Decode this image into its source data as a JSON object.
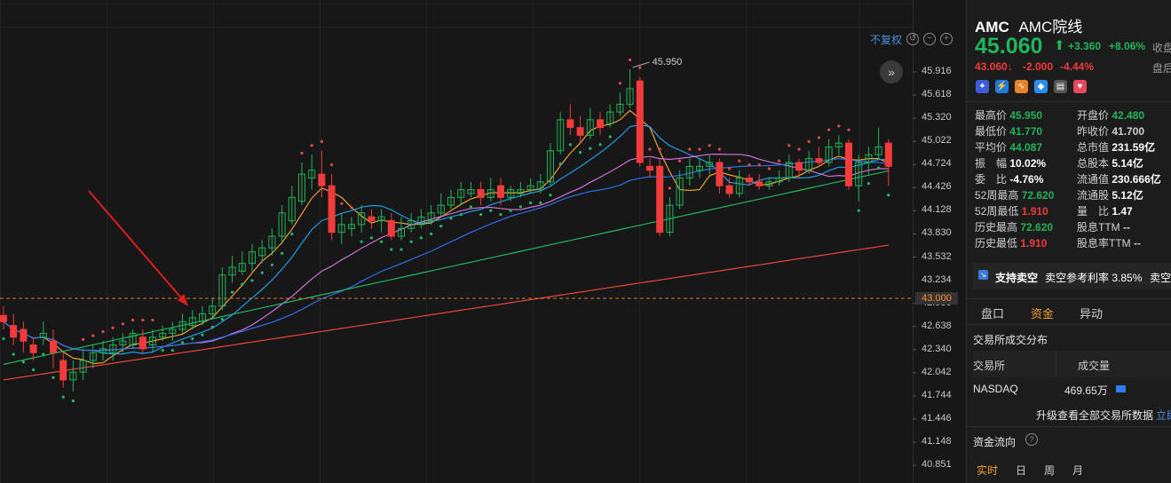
{
  "header": {
    "symbol": "AMC",
    "name": "AMC院线",
    "price": "45.060",
    "arrow": "⬆",
    "change": "+3.360",
    "change_pct": "+8.06%",
    "close_label": "收盘",
    "after_price": "43.060↓",
    "after_change": "-2.000",
    "after_pct": "-4.44%",
    "after_label": "盘后"
  },
  "toolbar": {
    "fq_label": "不复权"
  },
  "stats": [
    {
      "label": "最高价",
      "value": "45.950",
      "color": "#21b45a",
      "label2": "开盘价",
      "value2": "42.480",
      "color2": "#21b45a"
    },
    {
      "label": "最低价",
      "value": "41.770",
      "color": "#21b45a",
      "label2": "昨收价",
      "value2": "41.700",
      "color2": "#cfcfcf"
    },
    {
      "label": "平均价",
      "value": "44.087",
      "color": "#21b45a",
      "label2": "总市值",
      "value2": "231.59亿",
      "color2": "#ffffff"
    },
    {
      "label": "振　幅",
      "value": "10.02%",
      "color": "#ffffff",
      "label2": "总股本",
      "value2": "5.14亿",
      "color2": "#ffffff"
    },
    {
      "label": "委　比",
      "value": "-4.76%",
      "color": "#ffffff",
      "label2": "流通值",
      "value2": "230.666亿",
      "color2": "#ffffff"
    },
    {
      "label": "52周最高",
      "value": "72.620",
      "color": "#21b45a",
      "label2": "流通股",
      "value2": "5.12亿",
      "color2": "#ffffff"
    },
    {
      "label": "52周最低",
      "value": "1.910",
      "color": "#f23b3b",
      "label2": "量　比",
      "value2": "1.47",
      "color2": "#ffffff"
    },
    {
      "label": "历史最高",
      "value": "72.620",
      "color": "#21b45a",
      "label2": "股息TTM",
      "value2": "--",
      "color2": "#cfcfcf"
    },
    {
      "label": "历史最低",
      "value": "1.910",
      "color": "#f23b3b",
      "label2": "股息率TTM",
      "value2": "--",
      "color2": "#cfcfcf"
    }
  ],
  "short": {
    "text": "支持卖空",
    "rate": "卖空参考利率 3.85%",
    "more": "卖空"
  },
  "tabs": {
    "t1": "盘口",
    "t2": "资金",
    "t3": "异动"
  },
  "exchange": {
    "title": "交易所成交分布",
    "col1": "交易所",
    "col2": "成交量",
    "name": "NASDAQ",
    "volume": "469.65万",
    "upgrade": "升级查看全部交易所数据",
    "upgrade_link": "立即"
  },
  "flow": {
    "title": "资金流向",
    "tabs": [
      "实时",
      "日",
      "周",
      "月"
    ]
  },
  "colors": {
    "up": "#f23b3b",
    "down": "#21b45a",
    "ma5": "#f0a030",
    "ma10": "#1f9ce6",
    "ma20": "#d070d8",
    "ma30": "#2e6fe8",
    "ma60": "#22b866",
    "ma120": "#e8453c",
    "sar": "#e04a4a",
    "sar_below": "#22b866",
    "accent": "#4a90e2"
  },
  "chart_data": {
    "type": "candlestick",
    "y_ticks": [
      "45.916",
      "45.618",
      "45.320",
      "45.022",
      "44.724",
      "44.426",
      "44.128",
      "43.830",
      "43.532",
      "43.234",
      "42.936",
      "42.638",
      "42.340",
      "42.042",
      "41.744",
      "41.446",
      "41.148",
      "40.851"
    ],
    "ylim": [
      40.851,
      45.916
    ],
    "current_price_label": "43.000",
    "current_price_line": 43.0,
    "annotation": "45.950",
    "candles": [
      [
        42.78,
        42.7,
        42.9,
        42.6
      ],
      [
        42.65,
        42.5,
        42.8,
        42.4
      ],
      [
        42.6,
        42.45,
        42.7,
        42.3
      ],
      [
        42.4,
        42.3,
        42.5,
        42.2
      ],
      [
        42.5,
        42.55,
        42.7,
        42.4
      ],
      [
        42.45,
        42.3,
        42.6,
        42.1
      ],
      [
        42.2,
        41.95,
        42.3,
        41.85
      ],
      [
        41.95,
        42.05,
        42.2,
        41.8
      ],
      [
        42.05,
        42.2,
        42.35,
        41.95
      ],
      [
        42.2,
        42.3,
        42.4,
        42.1
      ],
      [
        42.3,
        42.35,
        42.45,
        42.2
      ],
      [
        42.3,
        42.4,
        42.5,
        42.2
      ],
      [
        42.4,
        42.45,
        42.55,
        42.3
      ],
      [
        42.4,
        42.55,
        42.6,
        42.35
      ],
      [
        42.5,
        42.35,
        42.6,
        42.3
      ],
      [
        42.4,
        42.5,
        42.6,
        42.3
      ],
      [
        42.5,
        42.55,
        42.65,
        42.45
      ],
      [
        42.55,
        42.6,
        42.7,
        42.45
      ],
      [
        42.6,
        42.7,
        42.8,
        42.55
      ],
      [
        42.65,
        42.75,
        42.85,
        42.6
      ],
      [
        42.7,
        42.8,
        42.9,
        42.65
      ],
      [
        42.8,
        42.9,
        43.0,
        42.75
      ],
      [
        42.9,
        43.3,
        43.4,
        42.85
      ],
      [
        43.3,
        43.4,
        43.55,
        43.2
      ],
      [
        43.35,
        43.45,
        43.6,
        43.3
      ],
      [
        43.45,
        43.6,
        43.7,
        43.35
      ],
      [
        43.55,
        43.65,
        43.75,
        43.45
      ],
      [
        43.65,
        43.8,
        43.9,
        43.55
      ],
      [
        43.8,
        44.1,
        44.2,
        43.7
      ],
      [
        44.0,
        44.3,
        44.45,
        43.95
      ],
      [
        44.25,
        44.6,
        44.75,
        44.2
      ],
      [
        44.55,
        44.65,
        44.85,
        44.4
      ],
      [
        44.6,
        44.45,
        44.9,
        44.3
      ],
      [
        44.45,
        43.85,
        44.6,
        43.75
      ],
      [
        43.85,
        43.95,
        44.1,
        43.7
      ],
      [
        43.9,
        43.95,
        44.05,
        43.8
      ],
      [
        43.95,
        44.1,
        44.2,
        43.85
      ],
      [
        44.05,
        44.0,
        44.15,
        43.9
      ],
      [
        44.0,
        44.05,
        44.15,
        43.85
      ],
      [
        44.0,
        43.8,
        44.1,
        43.75
      ],
      [
        43.8,
        43.9,
        44.05,
        43.75
      ],
      [
        43.9,
        44.0,
        44.1,
        43.85
      ],
      [
        43.95,
        44.05,
        44.15,
        43.9
      ],
      [
        44.0,
        44.1,
        44.2,
        43.95
      ],
      [
        44.1,
        44.2,
        44.35,
        44.05
      ],
      [
        44.2,
        44.3,
        44.4,
        44.15
      ],
      [
        44.3,
        44.4,
        44.5,
        44.2
      ],
      [
        44.35,
        44.4,
        44.5,
        44.3
      ],
      [
        44.4,
        44.3,
        44.5,
        44.2
      ],
      [
        44.3,
        44.4,
        44.55,
        44.25
      ],
      [
        44.45,
        44.3,
        44.55,
        44.2
      ],
      [
        44.3,
        44.4,
        44.45,
        44.25
      ],
      [
        44.35,
        44.4,
        44.5,
        44.3
      ],
      [
        44.4,
        44.45,
        44.55,
        44.35
      ],
      [
        44.4,
        44.5,
        44.6,
        44.35
      ],
      [
        44.5,
        44.9,
        45.0,
        44.45
      ],
      [
        44.9,
        45.3,
        45.4,
        44.85
      ],
      [
        45.3,
        45.2,
        45.5,
        45.1
      ],
      [
        45.2,
        45.1,
        45.35,
        45.0
      ],
      [
        45.1,
        45.3,
        45.45,
        45.05
      ],
      [
        45.3,
        45.2,
        45.4,
        45.1
      ],
      [
        45.25,
        45.4,
        45.5,
        45.2
      ],
      [
        45.4,
        45.5,
        45.65,
        45.35
      ],
      [
        45.5,
        45.7,
        45.95,
        45.45
      ],
      [
        45.8,
        44.75,
        45.85,
        44.7
      ],
      [
        44.7,
        44.65,
        44.8,
        44.55
      ],
      [
        44.7,
        43.85,
        44.8,
        43.8
      ],
      [
        43.85,
        44.2,
        44.3,
        43.8
      ],
      [
        44.2,
        44.55,
        44.65,
        44.15
      ],
      [
        44.55,
        44.7,
        44.8,
        44.45
      ],
      [
        44.65,
        44.7,
        44.8,
        44.55
      ],
      [
        44.7,
        44.75,
        44.85,
        44.6
      ],
      [
        44.75,
        44.45,
        44.8,
        44.35
      ],
      [
        44.45,
        44.35,
        44.55,
        44.3
      ],
      [
        44.35,
        44.55,
        44.65,
        44.3
      ],
      [
        44.55,
        44.5,
        44.6,
        44.45
      ],
      [
        44.5,
        44.45,
        44.6,
        44.4
      ],
      [
        44.45,
        44.5,
        44.55,
        44.4
      ],
      [
        44.5,
        44.55,
        44.65,
        44.45
      ],
      [
        44.55,
        44.75,
        44.85,
        44.5
      ],
      [
        44.75,
        44.65,
        44.8,
        44.55
      ],
      [
        44.65,
        44.8,
        44.9,
        44.6
      ],
      [
        44.8,
        44.75,
        44.95,
        44.7
      ],
      [
        44.75,
        44.95,
        45.05,
        44.7
      ],
      [
        44.95,
        45.0,
        45.1,
        44.85
      ],
      [
        45.0,
        44.45,
        45.05,
        44.4
      ],
      [
        44.45,
        44.75,
        44.85,
        44.25
      ],
      [
        44.75,
        44.85,
        44.95,
        44.6
      ],
      [
        44.85,
        44.95,
        45.2,
        44.8
      ],
      [
        45.0,
        44.7,
        45.05,
        44.45
      ]
    ]
  }
}
